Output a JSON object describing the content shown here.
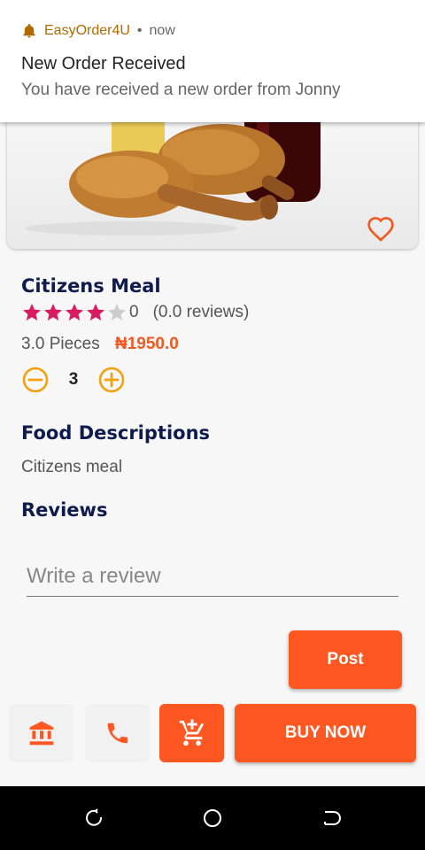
{
  "notification": {
    "app_name": "EasyOrder4U",
    "separator": "•",
    "time": "now",
    "title": "New Order Received",
    "body": "You have received a new order from Jonny"
  },
  "product": {
    "name": "Citizens Meal",
    "rating": 4,
    "rating_max": 5,
    "rating_value": "0",
    "reviews_text": "(0.0 reviews)",
    "pieces": "3.0 Pieces",
    "price": "₦1950.0",
    "quantity": "3"
  },
  "sections": {
    "description_title": "Food Descriptions",
    "description_text": "Citizens meal",
    "reviews_title": "Reviews"
  },
  "review_form": {
    "placeholder": "Write a review",
    "post_label": "Post"
  },
  "bottom_bar": {
    "buy_label": "BUY NOW",
    "icons": [
      "bank-icon",
      "phone-icon",
      "add-to-cart-icon"
    ]
  },
  "system_nav": {
    "icons": [
      "recents-icon",
      "home-icon",
      "back-icon"
    ]
  },
  "colors": {
    "accent": "#ff5722",
    "price": "#f05a22",
    "title": "#0f1b4c",
    "star": "#d81b60",
    "star_empty": "#cccccc",
    "icon_orange": "#f5a00e"
  }
}
